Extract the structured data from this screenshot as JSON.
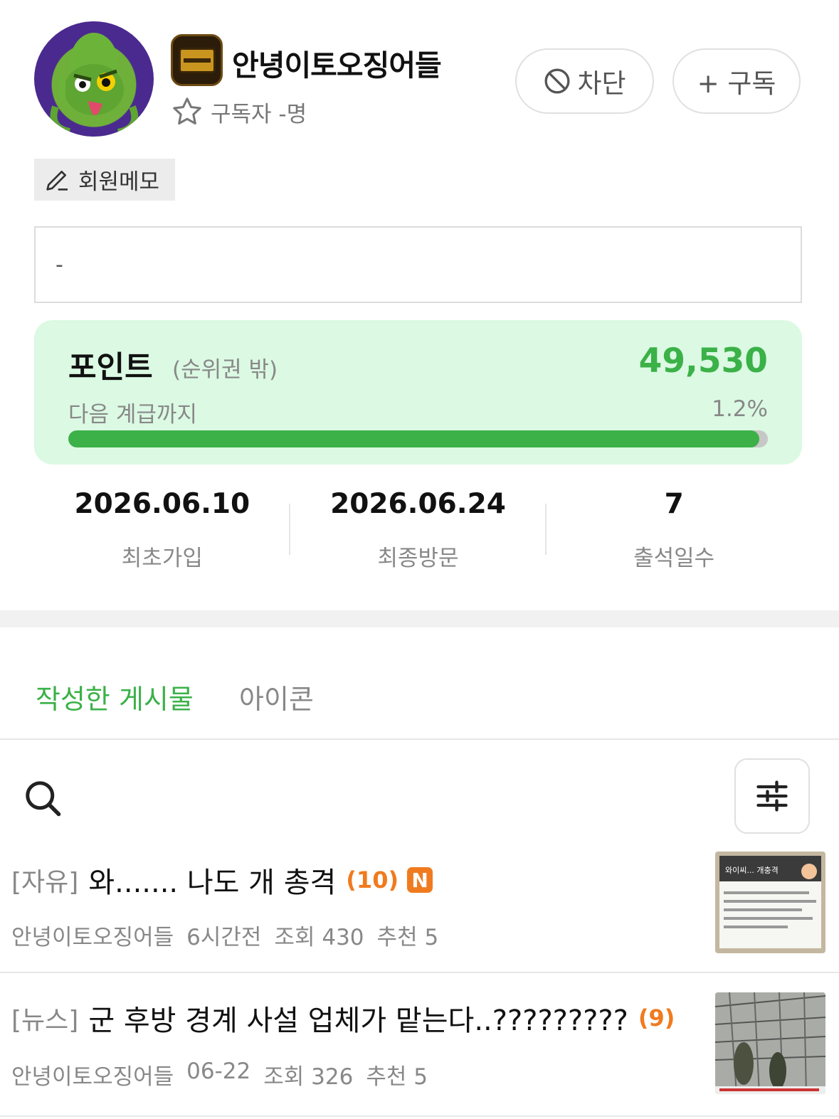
{
  "profile": {
    "username": "안녕이토오징어들",
    "subscriber_text": "구독자 -명",
    "block_label": "차단",
    "subscribe_label": "+ 구독",
    "memo_tag_label": "회원메모",
    "memo_text": "-"
  },
  "points": {
    "title": "포인트",
    "rank": "(순위권 밖)",
    "value": "49,530",
    "next_label": "다음 계급까지",
    "next_percent": "1.2%",
    "progress_fill_fraction": 0.988
  },
  "stats": [
    {
      "value": "2026.06.10",
      "label": "최초가입"
    },
    {
      "value": "2026.06.24",
      "label": "최종방문"
    },
    {
      "value": "7",
      "label": "출석일수"
    }
  ],
  "tabs": [
    {
      "label": "작성한 게시물",
      "active": true
    },
    {
      "label": "아이콘",
      "active": false
    }
  ],
  "posts": [
    {
      "board": "[자유]",
      "title": "와....... 나도 개 총격",
      "comments": "(10)",
      "new_badge": "N",
      "author": "안녕이토오징어들",
      "time": "6시간전",
      "views": "조회 430",
      "likes": "추천 5",
      "thumb_text": "와이씨... 개충격"
    },
    {
      "board": "[뉴스]",
      "title": "군 후방 경계 사설 업체가 맡는다..?????????",
      "comments": "(9)",
      "author": "안녕이토오징어들",
      "time": "06-22",
      "views": "조회 326",
      "likes": "추천 5"
    }
  ],
  "colors": {
    "accent_green": "#3bb148",
    "points_bg": "#dbf9e3",
    "comment_orange": "#f07b1f"
  }
}
